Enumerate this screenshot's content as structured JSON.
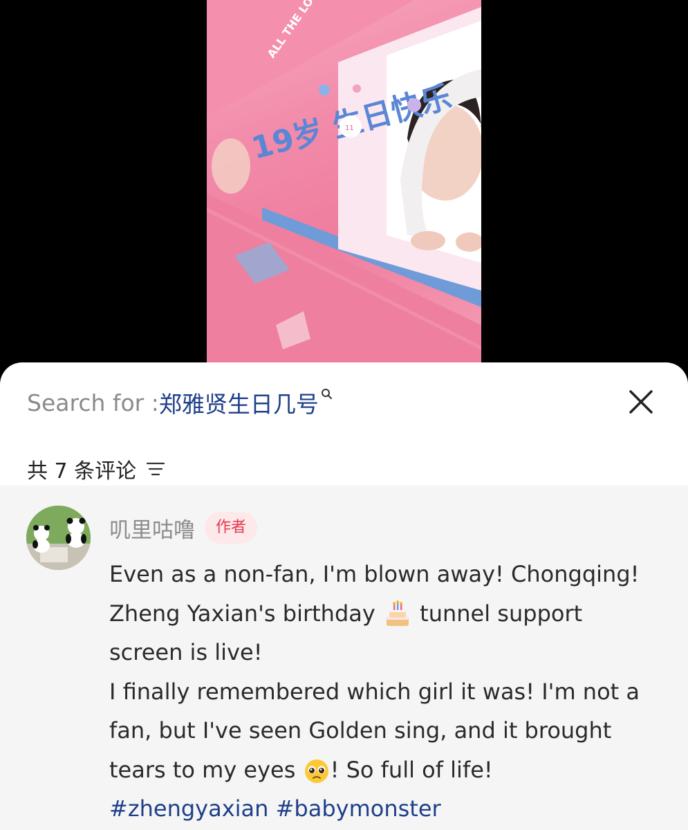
{
  "video": {
    "banner_text": "ALL THE LOVE",
    "birthday_text": "19岁 生日快乐",
    "badge": "11"
  },
  "search": {
    "prefix": "Search for : ",
    "query": "郑雅贤生日几号"
  },
  "comments_header": {
    "count_label": "共 7 条评论"
  },
  "comment": {
    "username": "叽里咕噜",
    "badge": "作者",
    "line1": "Even as a non-fan, I'm blown away! Chongqing!",
    "line2a": "Zheng Yaxian's birthday ",
    "line2b": " tunnel support",
    "line3": "screen is live!",
    "line4": "I finally remembered which girl it was! I'm not a",
    "line5": "fan, but I've seen Golden sing, and it brought",
    "line6a": "tears to my eyes ",
    "line6b": "! So full of life!",
    "hashtags": [
      "#zhengyaxian",
      "#babymonster"
    ]
  },
  "icons": {
    "close": "close-icon",
    "sort": "sort-icon",
    "search": "search-icon",
    "cake": "birthday-cake-emoji",
    "pleading": "pleading-face-emoji"
  }
}
